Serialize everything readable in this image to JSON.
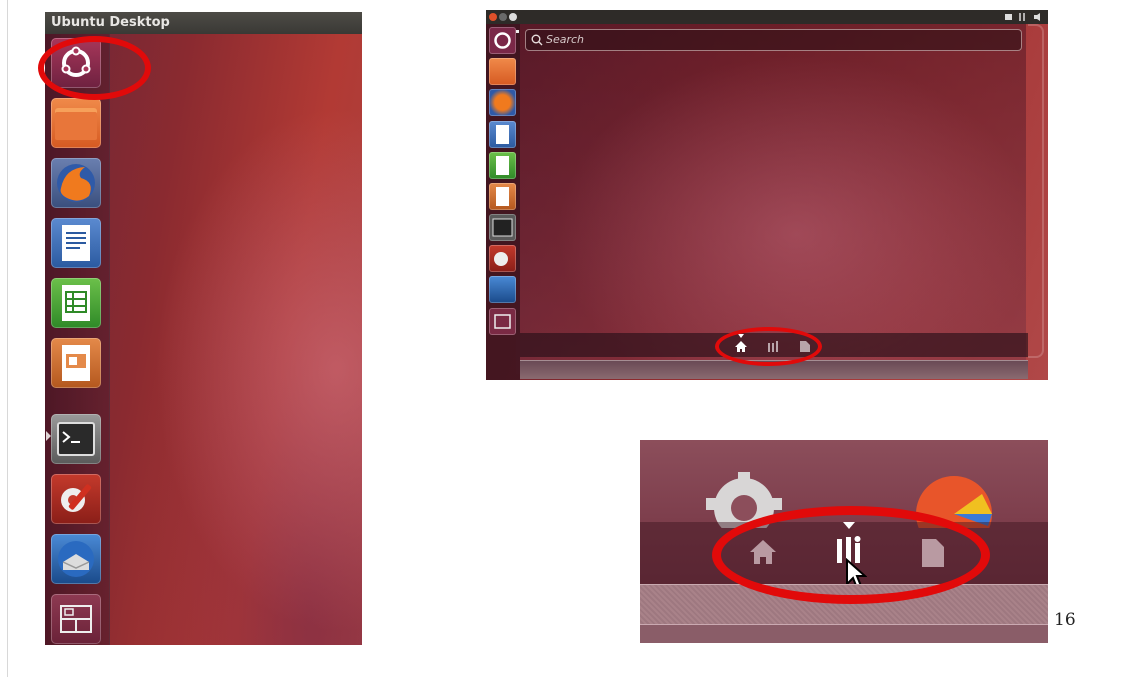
{
  "panel1": {
    "topbar_title": "Ubuntu Desktop"
  },
  "panel1_launcher_icons": [
    "ubuntu-dash-icon",
    "files-icon",
    "firefox-icon",
    "writer-icon",
    "calc-icon",
    "impress-icon",
    "terminal-icon",
    "settings-icon",
    "thunderbird-icon",
    "workspace-icon"
  ],
  "panel2": {
    "search_placeholder": "Search",
    "lenses": [
      "home-lens-icon",
      "applications-lens-icon",
      "files-lens-icon"
    ]
  },
  "panel3": {
    "lenses": [
      "home-lens-icon",
      "applications-lens-icon",
      "files-lens-icon"
    ]
  },
  "page_number": "16",
  "colors": {
    "highlight_ring": "#e10a0a",
    "panel_bar": "#3a3935"
  }
}
